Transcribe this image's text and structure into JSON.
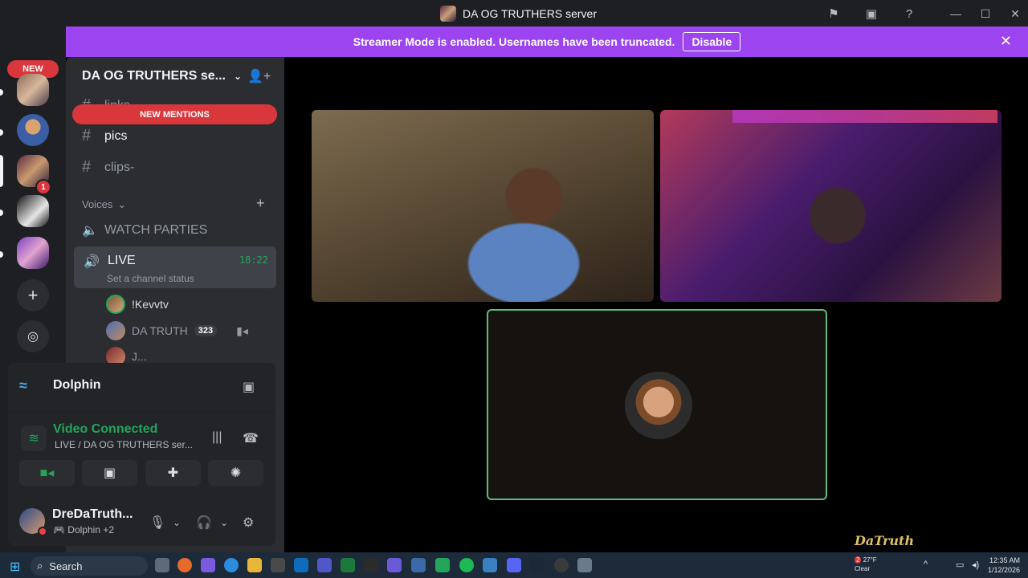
{
  "window": {
    "title": "DA OG TRUTHERS server"
  },
  "guilds": {
    "new_label": "NEW",
    "dm_badge": "1"
  },
  "banner": {
    "text": "Streamer Mode is enabled. Usernames have been truncated.",
    "button": "Disable"
  },
  "sidebar": {
    "server_name": "DA OG TRUTHERS se...",
    "new_mentions": "NEW MENTIONS",
    "channels": [
      {
        "name": "links"
      },
      {
        "name": "pics"
      },
      {
        "name": "clips-"
      }
    ],
    "category": "Voices",
    "voice_channels": [
      {
        "name": "WATCH PARTIES"
      }
    ],
    "live_channel": {
      "name": "LIVE",
      "time": "18:22",
      "status": "Set a channel status"
    },
    "voice_users": [
      {
        "name": "!Kevvtv"
      },
      {
        "name": "DA TRUTH",
        "badge": "323"
      },
      {
        "name": "J..."
      }
    ]
  },
  "panel": {
    "activity": "Dolphin",
    "connection_status": "Video Connected",
    "connection_detail": "LIVE / DA OG TRUTHERS ser...",
    "user_name": "DreDaTruth...",
    "user_activity": "Dolphin",
    "user_activity_extra": "+2"
  },
  "taskbar": {
    "search": "Search",
    "weather_temp": "27°F",
    "weather_desc": "Clear",
    "weather_badge": "2",
    "time": "12:35 AM",
    "date": "1/12/2026"
  },
  "watermark": "DaTruth",
  "colors": {
    "banner": "#9b44f0",
    "accent_green": "#23a55a",
    "danger": "#da373c"
  }
}
